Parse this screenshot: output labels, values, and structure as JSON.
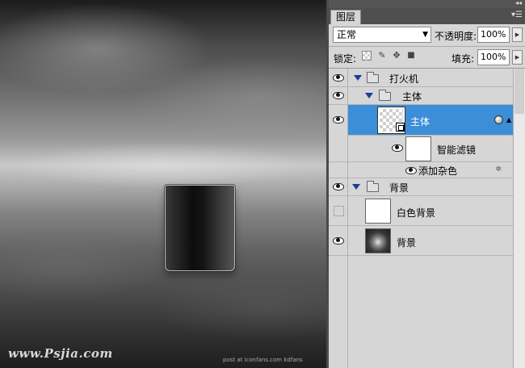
{
  "canvas": {
    "watermark": "www.Psjia.com",
    "credit": "post at iconfans.com  kdfans"
  },
  "panel": {
    "tab_label": "图层",
    "collapse_icon": "double-chevron-right-icon",
    "menu_icon": "panel-menu-icon",
    "blend_mode": "正常",
    "opacity_label": "不透明度:",
    "opacity_value": "100%",
    "lock_label": "锁定:",
    "fill_label": "填充:",
    "fill_value": "100%"
  },
  "layers": [
    {
      "label": "打火机",
      "type": "group",
      "visible": true,
      "expanded": true,
      "depth": 0
    },
    {
      "label": "主体",
      "type": "group",
      "visible": true,
      "expanded": true,
      "depth": 1
    },
    {
      "label": "主体",
      "type": "smart-object",
      "visible": true,
      "selected": true,
      "depth": 2
    },
    {
      "label": "智能滤镜",
      "type": "smart-filters",
      "visible": true,
      "depth": 3
    },
    {
      "label": "添加杂色",
      "type": "filter",
      "visible": true,
      "depth": 4
    },
    {
      "label": "背景",
      "type": "group",
      "visible": true,
      "expanded": true,
      "depth": 0
    },
    {
      "label": "白色背景",
      "type": "layer",
      "visible": false,
      "depth": 1
    },
    {
      "label": "背景",
      "type": "layer",
      "visible": true,
      "depth": 1
    }
  ],
  "colors": {
    "selection": "#3d8ed9",
    "panel_bg": "#d6d6d6",
    "expand_triangle": "#1a3d9a"
  }
}
